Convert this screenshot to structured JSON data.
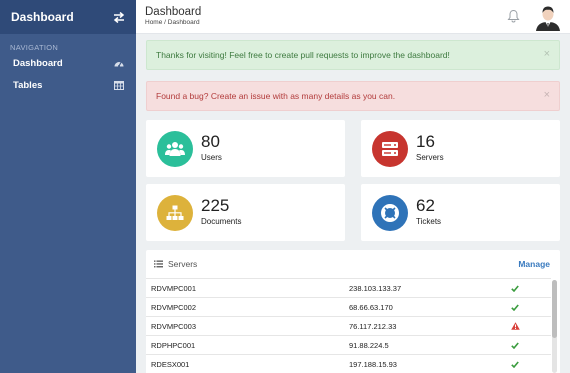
{
  "sidebar": {
    "brand": "Dashboard",
    "nav_heading": "NAVIGATION",
    "items": [
      {
        "label": "Dashboard",
        "icon": "dashboard-icon"
      },
      {
        "label": "Tables",
        "icon": "table-icon"
      }
    ]
  },
  "header": {
    "title": "Dashboard",
    "breadcrumb": "Home / Dashboard"
  },
  "alerts": {
    "success": "Thanks for visiting! Feel free to create pull requests to improve the dashboard!",
    "danger": "Found a bug? Create an issue with as many details as you can.",
    "close": "×"
  },
  "stats": [
    {
      "value": "80",
      "label": "Users",
      "color": "#2bbf9a",
      "icon": "users-icon"
    },
    {
      "value": "16",
      "label": "Servers",
      "color": "#c7352f",
      "icon": "server-icon"
    },
    {
      "value": "225",
      "label": "Documents",
      "color": "#ddb23b",
      "icon": "sitemap-icon"
    },
    {
      "value": "62",
      "label": "Tickets",
      "color": "#2f73b8",
      "icon": "lifebuoy-icon"
    }
  ],
  "servers_panel": {
    "title": "Servers",
    "manage": "Manage",
    "rows": [
      {
        "name": "RDVMPC001",
        "ip": "238.103.133.37",
        "status": "ok"
      },
      {
        "name": "RDVMPC002",
        "ip": "68.66.63.170",
        "status": "ok"
      },
      {
        "name": "RDVMPC003",
        "ip": "76.117.212.33",
        "status": "warning"
      },
      {
        "name": "RDPHPC001",
        "ip": "91.88.224.5",
        "status": "ok"
      },
      {
        "name": "RDESX001",
        "ip": "197.188.15.93",
        "status": "ok"
      }
    ]
  },
  "colors": {
    "sidebar": "#3f5b8a",
    "sidebar_header": "#2f4a78",
    "ok": "#3a9c3e",
    "warning": "#d9403a",
    "link": "#3a7bbf"
  }
}
